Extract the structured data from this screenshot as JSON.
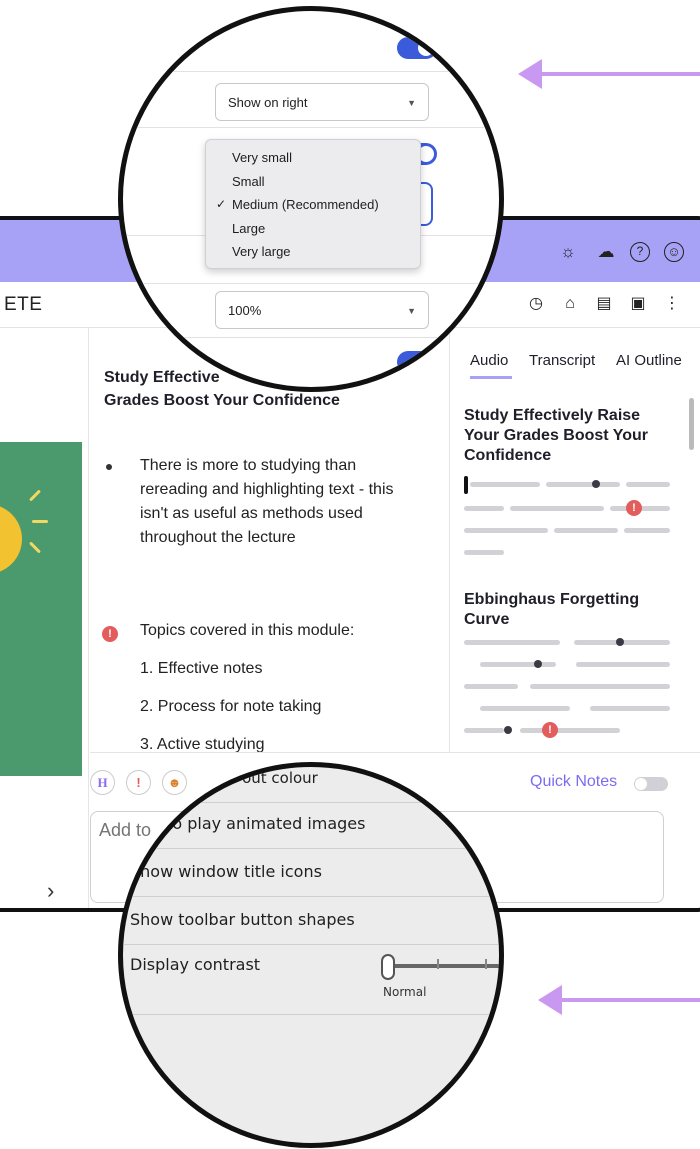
{
  "app": {
    "name": "ETE",
    "topbar_icons": [
      {
        "name": "sun-icon",
        "glyph": "☼"
      },
      {
        "name": "cloud-icon",
        "glyph": "☁"
      },
      {
        "name": "help-icon",
        "glyph": "?"
      },
      {
        "name": "account-icon",
        "glyph": "☺"
      }
    ],
    "toolbar_icons": [
      {
        "name": "timer-icon",
        "glyph": "◷"
      },
      {
        "name": "graduation-cap-icon",
        "glyph": "⌂"
      },
      {
        "name": "document-icon",
        "glyph": "▤"
      },
      {
        "name": "layout-icon",
        "glyph": "▣"
      },
      {
        "name": "more-icon",
        "glyph": "⋮"
      }
    ],
    "accent_color": "#a8a2f6"
  },
  "notes": {
    "title_line1": "Study Effective",
    "title_line2": "Grades Boost Your Confidence",
    "bullet": "There is more to studying than rereading and highlighting text - this isn't as useful as methods used throughout the lecture",
    "alert_glyph": "!",
    "topics_heading": "Topics covered in this module:",
    "topics": [
      "1. Effective notes",
      "2. Process for note taking",
      "3. Active studying"
    ]
  },
  "side_panel": {
    "tabs": [
      "Audio",
      "Transcript",
      "AI Outline"
    ],
    "active_tab": "Audio",
    "section1_title": "Study Effectively Raise Your Grades Boost Your Confidence",
    "section2_title": "Ebbinghaus Forgetting Curve"
  },
  "bottom": {
    "chip_heading": "H",
    "chip_alert": "!",
    "chip_emoji": "☻",
    "quick_notes_label": "Quick Notes",
    "quick_notes_on": false,
    "note_placeholder": "Add to",
    "chevron": "›"
  },
  "settings_top": {
    "position_select": "Show on right",
    "size_options": [
      "Very small",
      "Small",
      "Medium (Recommended)",
      "Large",
      "Very large"
    ],
    "size_selected": "Medium (Recommended)",
    "zoom_select": "100%",
    "toggles_on": true,
    "check_glyph": "✓",
    "caret_glyph": "▼"
  },
  "settings_bottom": {
    "partial_label": "... out colour",
    "rows": [
      "Add to play animated images",
      "Show window title icons",
      "Show toolbar button shapes",
      "Display contrast"
    ],
    "contrast_value": "Normal",
    "contrast_level": 0
  },
  "arrow_color": "#c998f0"
}
